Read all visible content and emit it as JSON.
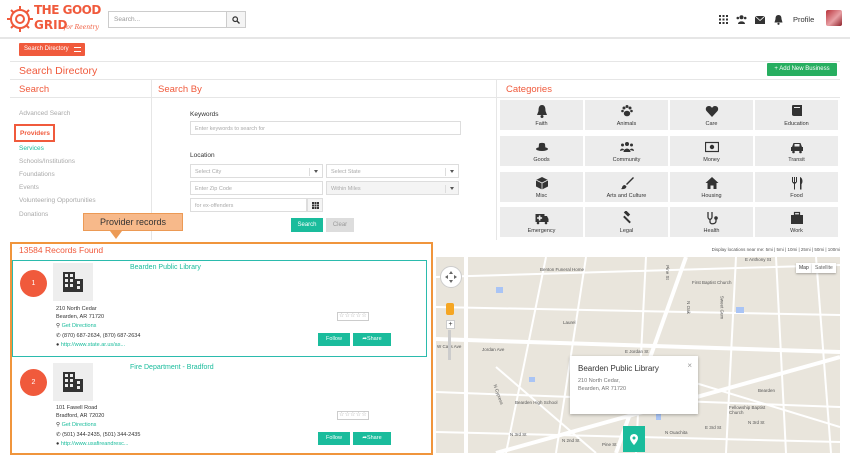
{
  "header": {
    "logo_line1": "THE GOOD",
    "logo_line2": "GRID",
    "logo_tagline": "for Reentry",
    "search_placeholder": "Search...",
    "profile_label": "Profile",
    "icons": [
      "grid-icon",
      "users-icon",
      "envelope-icon",
      "bell-icon"
    ]
  },
  "toolbar": {
    "search_directory_label": "Search Directory",
    "page_title": "Search Directory",
    "add_business_label": "+ Add New Business"
  },
  "left": {
    "title": "Search",
    "items": [
      "Advanced Search",
      "Providers",
      "Services",
      "Schools/Institutions",
      "Foundations",
      "Events",
      "Volunteering Opportunities",
      "Donations"
    ]
  },
  "search_by": {
    "title": "Search By",
    "keywords_label": "Keywords",
    "keywords_placeholder": "Enter keywords to search for",
    "location_label": "Location",
    "city_placeholder": "Select City",
    "state_placeholder": "Select State",
    "zip_placeholder": "Enter Zip Code",
    "miles_placeholder": "Within Miles",
    "exoffenders_placeholder": "for ex-offenders",
    "search_button": "Search",
    "clear_button": "Clear"
  },
  "categories": {
    "title": "Categories",
    "items": [
      {
        "label": "Faith",
        "icon": "bell-icon"
      },
      {
        "label": "Animals",
        "icon": "paw-icon"
      },
      {
        "label": "Care",
        "icon": "heart-icon"
      },
      {
        "label": "Education",
        "icon": "book-icon"
      },
      {
        "label": "Goods",
        "icon": "hat-icon"
      },
      {
        "label": "Community",
        "icon": "community-icon"
      },
      {
        "label": "Money",
        "icon": "money-icon"
      },
      {
        "label": "Transit",
        "icon": "car-icon"
      },
      {
        "label": "Misc",
        "icon": "cube-icon"
      },
      {
        "label": "Arts and Culture",
        "icon": "brush-icon"
      },
      {
        "label": "Housing",
        "icon": "home-icon"
      },
      {
        "label": "Food",
        "icon": "utensils-icon"
      },
      {
        "label": "Emergency",
        "icon": "ambulance-icon"
      },
      {
        "label": "Legal",
        "icon": "gavel-icon"
      },
      {
        "label": "Health",
        "icon": "stethoscope-icon"
      },
      {
        "label": "Work",
        "icon": "briefcase-icon"
      }
    ]
  },
  "callout": "Provider records",
  "records": {
    "count_label": "13584 Records Found",
    "items": [
      {
        "num": "1",
        "title": "Bearden Public Library",
        "addr1": "210 North Cedar",
        "addr2": "Bearden, AR 71720",
        "directions": "Get Directions",
        "phone": "(870) 687-2634, (870) 687-2634",
        "url": "http://www.state.ar.us/as...",
        "rating": "☆☆☆☆☆",
        "follow": "Follow",
        "share": "Share"
      },
      {
        "num": "2",
        "title": "Fire Department - Bradford",
        "addr1": "101 Fawell Road",
        "addr2": "Bradford, AR 72020",
        "directions": "Get Directions",
        "phone": "(501) 344-2435, (501) 344-2435",
        "url": "http://www.usafireandresc...",
        "rating": "☆☆☆☆☆",
        "follow": "Follow",
        "share": "Share"
      }
    ]
  },
  "map": {
    "info": "Display locations near me: 5mi | 5mi | 10mi | 25mi | 50mi | 100mi",
    "map_button": "Map",
    "satellite_button": "Satellite",
    "labels": [
      "Benton Funeral Home",
      "First Baptist Church",
      "Laurel",
      "Pine St",
      "N Oak",
      "Sweet Gum",
      "W Cass Ave",
      "Jordan Ave",
      "E Jordan St",
      "Bearden High School",
      "Fellowship Baptist Church",
      "E 3rd St",
      "N 3rd St",
      "E Anthony St",
      "Bearden",
      "N Cypress",
      "N 3rd St",
      "N 2nd St",
      "Pine St",
      "N Ouachita"
    ],
    "popup": {
      "title": "Bearden Public Library",
      "addr1": "210 North Cedar,",
      "addr2": "Bearden, AR 71720",
      "close": "×"
    }
  }
}
